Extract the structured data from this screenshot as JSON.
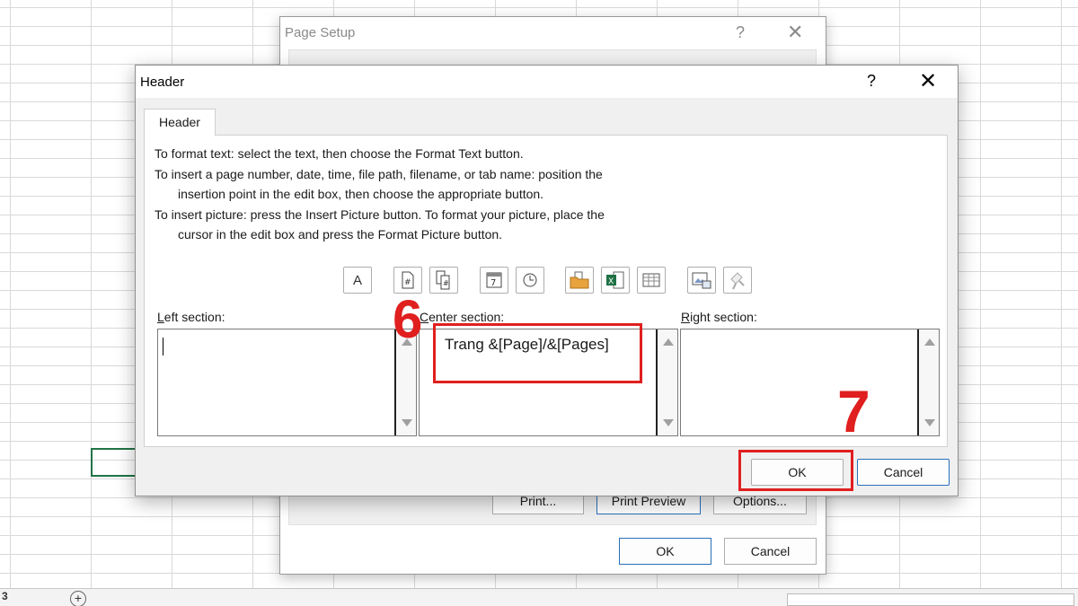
{
  "background": {
    "status_left_glyph": "3",
    "status_add_sheet": "+"
  },
  "page_setup": {
    "title": "Page Setup",
    "help": "?",
    "close": "✕",
    "buttons": {
      "print": "Print...",
      "print_preview": "Print Preview",
      "options": "Options...",
      "ok": "OK",
      "cancel": "Cancel"
    }
  },
  "header_dialog": {
    "title": "Header",
    "help": "?",
    "close": "✕",
    "tab": "Header",
    "instructions": [
      "To format text:  select the text, then choose the Format Text button.",
      "To insert a page number, date, time, file path, filename, or tab name:  position the",
      "insertion point in the edit box, then choose the appropriate button.",
      "To insert picture: press the Insert Picture button.  To format your picture, place the",
      "cursor in the edit box and press the Format Picture button."
    ],
    "toolbar": [
      "format-text-icon",
      "insert-page-number-icon",
      "insert-number-of-pages-icon",
      "insert-date-icon",
      "insert-time-icon",
      "insert-file-path-icon",
      "insert-file-name-icon",
      "insert-sheet-name-icon",
      "insert-picture-icon",
      "format-picture-icon"
    ],
    "sections": {
      "left": {
        "label_key": "L",
        "label_rest": "eft section:",
        "value": ""
      },
      "center": {
        "label_key": "C",
        "label_rest": "enter section:",
        "value": "Trang &[Page]/&[Pages]"
      },
      "right": {
        "label_key": "R",
        "label_rest": "ight section:",
        "value": ""
      }
    },
    "buttons": {
      "ok": "OK",
      "cancel": "Cancel"
    }
  },
  "annotations": {
    "step6": "6",
    "step7": "7",
    "color": "#e01f1f"
  }
}
